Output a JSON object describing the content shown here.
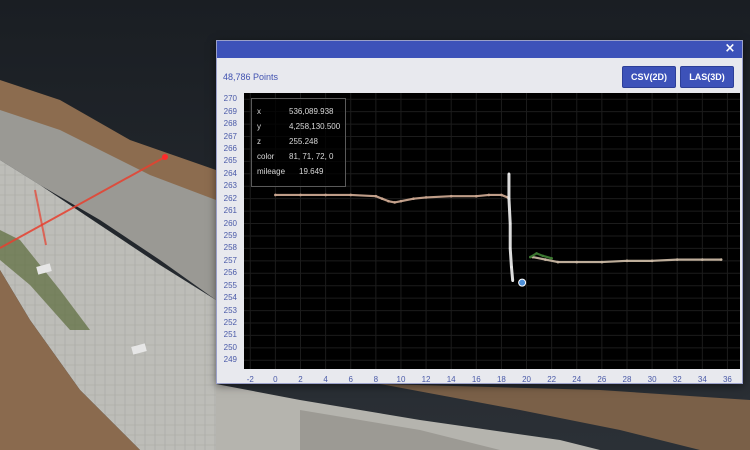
{
  "dialog": {
    "close_icon": "×",
    "points_count": "48,786 Points",
    "buttons": {
      "csv": "CSV(2D)",
      "las": "LAS(3D)"
    }
  },
  "info": {
    "x_label": "x",
    "x_value": "536,089.938",
    "y_label": "y",
    "y_value": "4,258,130.500",
    "z_label": "z",
    "z_value": "255.248",
    "color_label": "color",
    "color_value": "81, 71, 72, 0",
    "mileage_label": "mileage",
    "mileage_value": "19.649"
  },
  "chart_data": {
    "type": "scatter",
    "title": "",
    "xlabel": "",
    "ylabel": "",
    "xlim": [
      -2.5,
      37
    ],
    "ylim": [
      248.3,
      270.5
    ],
    "x_ticks": [
      "-2",
      "0",
      "2",
      "4",
      "6",
      "8",
      "10",
      "12",
      "14",
      "16",
      "18",
      "20",
      "22",
      "24",
      "26",
      "28",
      "30",
      "32",
      "34",
      "36"
    ],
    "y_ticks": [
      "270",
      "269",
      "268",
      "267",
      "266",
      "265",
      "264",
      "263",
      "262",
      "261",
      "260",
      "259",
      "258",
      "257",
      "256",
      "255",
      "254",
      "253",
      "252",
      "251",
      "250",
      "249"
    ],
    "grid": true,
    "series": [
      {
        "values_x": [
          0,
          2,
          4,
          6,
          8,
          8.5,
          9,
          9.5,
          10,
          11,
          12,
          14,
          16,
          17,
          18,
          18.5,
          18.6
        ],
        "values_y": [
          262.3,
          262.3,
          262.3,
          262.3,
          262.2,
          262.0,
          261.8,
          261.7,
          261.8,
          262.0,
          262.1,
          262.2,
          262.2,
          262.3,
          262.3,
          262.1,
          262.0
        ],
        "color": "#c9a58f"
      },
      {
        "values_x": [
          18.6,
          18.6,
          18.7,
          18.7,
          18.8,
          18.9
        ],
        "values_y": [
          264.0,
          262.0,
          260.0,
          258.0,
          256.5,
          255.4
        ],
        "color": "#e8e8e8"
      },
      {
        "values_x": [
          20.5,
          21.5,
          22.5,
          24,
          26,
          28,
          30,
          32,
          34,
          35.5
        ],
        "values_y": [
          257.3,
          257.1,
          256.9,
          256.9,
          256.9,
          257.0,
          257.0,
          257.1,
          257.1,
          257.1
        ],
        "color": "#c8b6a2"
      },
      {
        "values_x": [
          20.3,
          20.8,
          21.3,
          22.0
        ],
        "values_y": [
          257.3,
          257.6,
          257.4,
          257.2
        ],
        "color": "#3d7a32"
      }
    ],
    "selected_point": {
      "x": 19.649,
      "y": 255.248,
      "color": "#4d8fd8"
    }
  },
  "scene_colors": {
    "background": "#1f2328",
    "dirt": "#8a6a50",
    "wall": "#b9b9b4",
    "road": "#8f8f8c",
    "measure_line": "#e8402f"
  }
}
